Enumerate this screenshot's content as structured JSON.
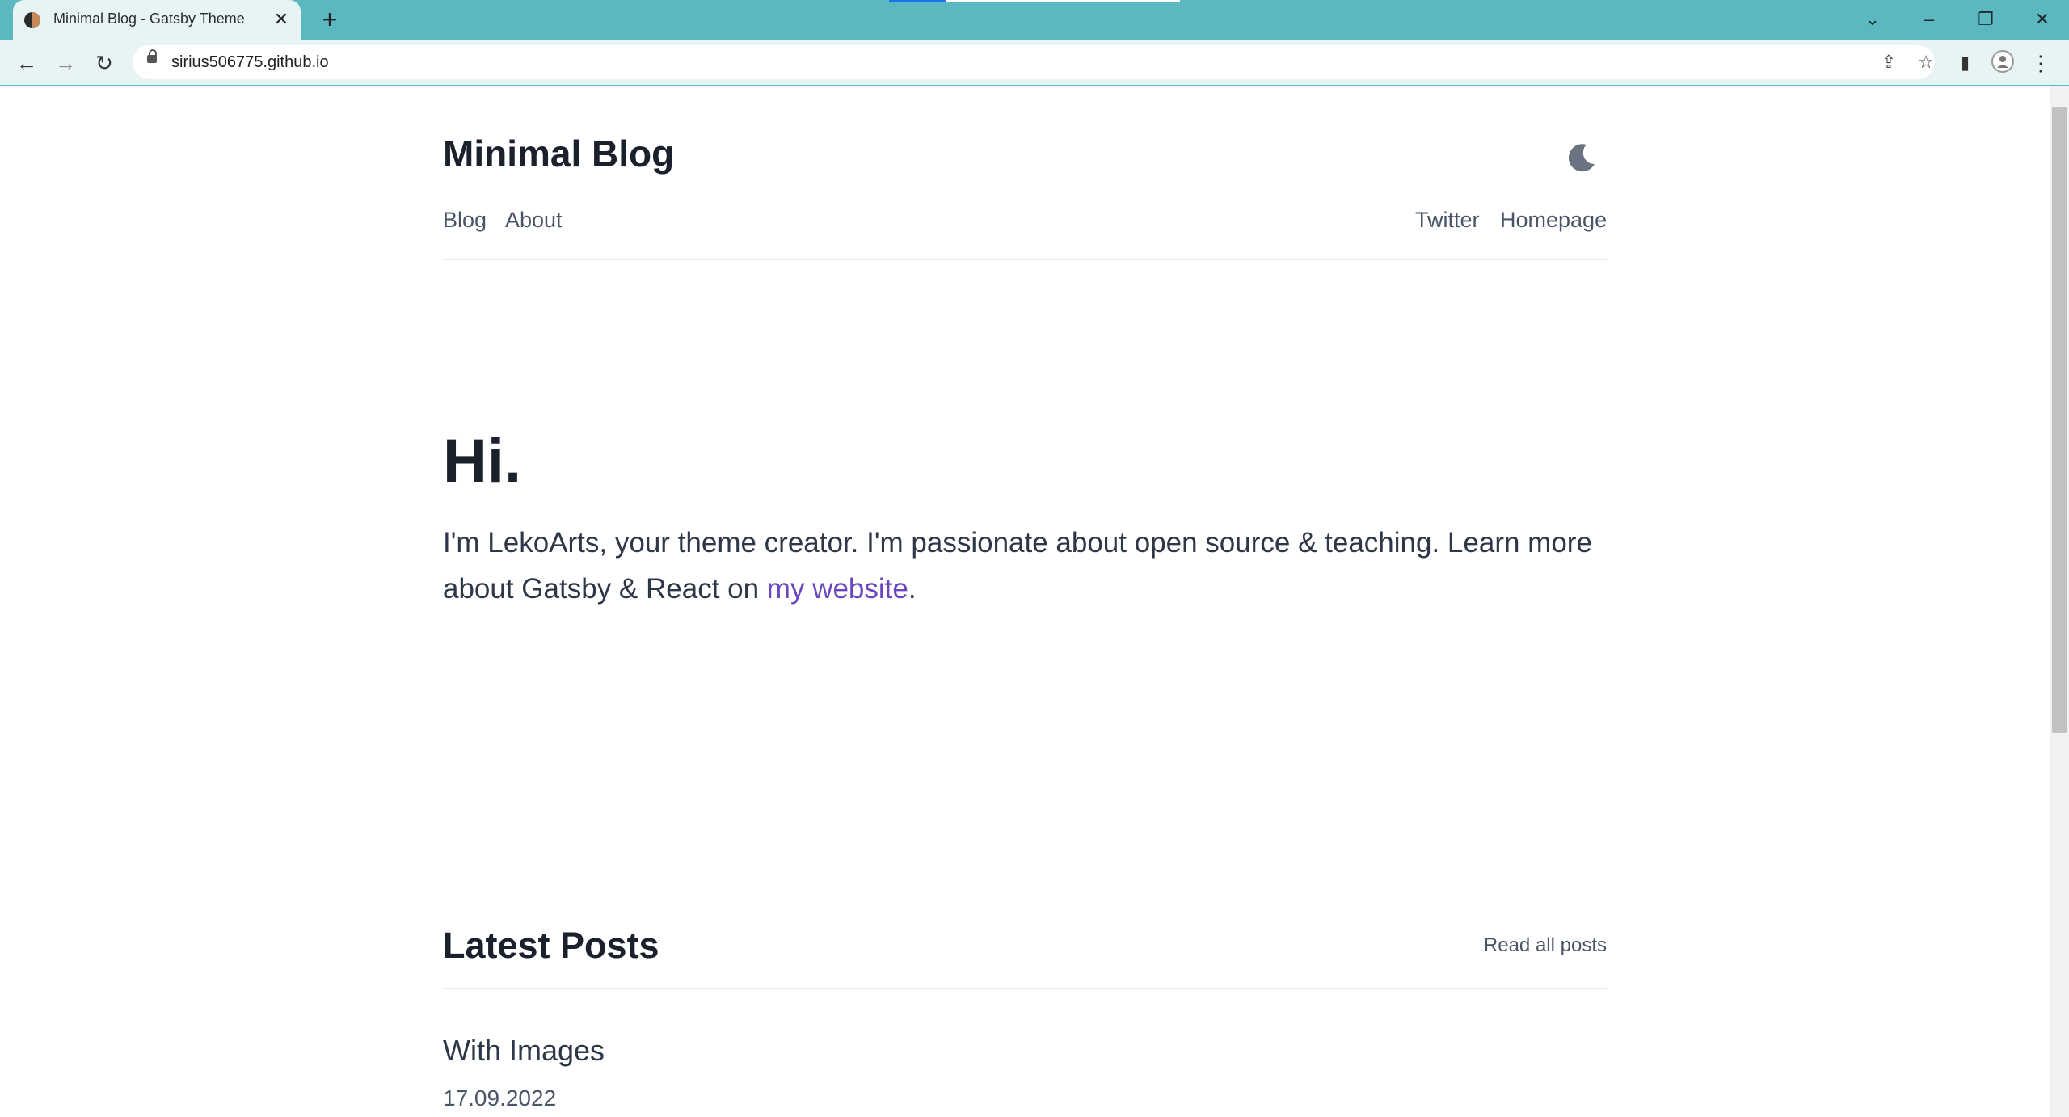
{
  "browser": {
    "tab_title": "Minimal Blog - Gatsby Theme",
    "url": "sirius506775.github.io",
    "accent_color": "#5bb8c0"
  },
  "site": {
    "title": "Minimal Blog",
    "nav_left": [
      "Blog",
      "About"
    ],
    "nav_right": [
      "Twitter",
      "Homepage"
    ],
    "theme_toggle_icon": "moon-icon"
  },
  "hero": {
    "title": "Hi.",
    "text_before": "I'm LekoArts, your theme creator. I'm passionate about open source & teaching. Learn more about Gatsby & React on ",
    "link_text": "my website",
    "text_after": ".",
    "link_color": "#6b46c1"
  },
  "latest": {
    "title": "Latest Posts",
    "read_all": "Read all posts",
    "posts": [
      {
        "title": "With Images",
        "date": "17.09.2022"
      }
    ]
  }
}
